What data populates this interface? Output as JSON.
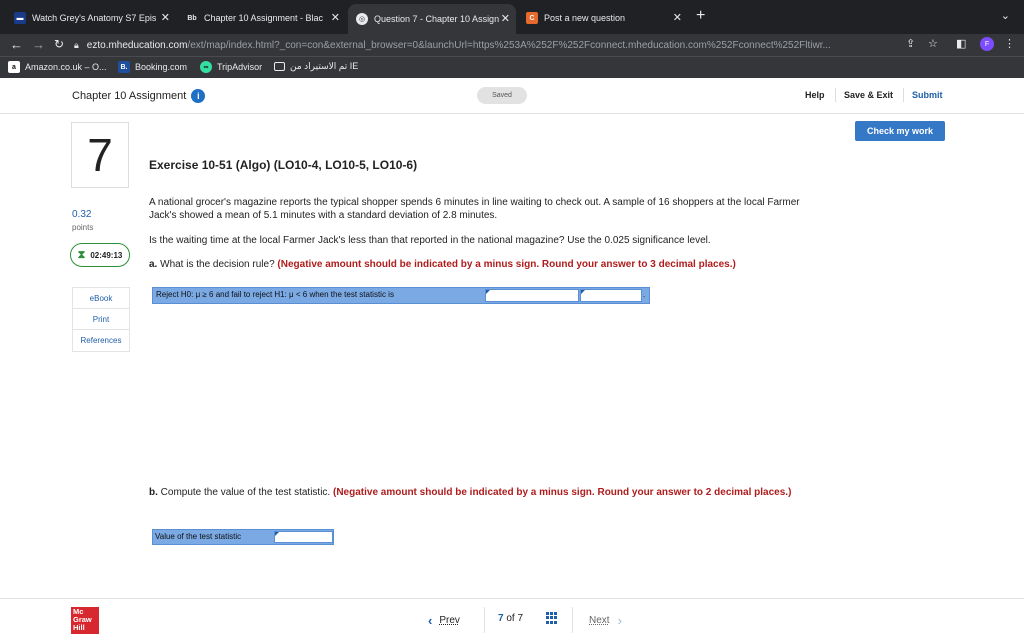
{
  "browser": {
    "tabs": [
      {
        "label": "Watch Grey's Anatomy S7 Epis",
        "icon": "tv-icon"
      },
      {
        "label": "Chapter 10 Assignment - Blac",
        "icon": "blackboard-icon"
      },
      {
        "label": "Question 7 - Chapter 10 Assign",
        "icon": "connect-icon"
      },
      {
        "label": "Post a new question",
        "icon": "chegg-icon"
      }
    ],
    "url_host": "ezto.mheducation.com",
    "url_path": "/ext/map/index.html?_con=con&external_browser=0&launchUrl=https%253A%252F%252Fconnect.mheducation.com%252Fconnect%252Fltiwr...",
    "profile_initial": "F",
    "bookmarks": [
      "Amazon.co.uk – O...",
      "Booking.com",
      "TripAdvisor",
      "تم الاستيراد من IE"
    ]
  },
  "header": {
    "assignment_title": "Chapter 10 Assignment",
    "saved": "Saved",
    "help": "Help",
    "save_exit": "Save & Exit",
    "submit": "Submit",
    "check_work": "Check my work"
  },
  "sidebar": {
    "question_number": "7",
    "points_value": "0.32",
    "points_label": "points",
    "timer": "02:49:13",
    "links": [
      "eBook",
      "Print",
      "References"
    ]
  },
  "question": {
    "title": "Exercise 10-51 (Algo) (LO10-4, LO10-5, LO10-6)",
    "intro": "A national grocer's magazine reports the typical shopper spends 6 minutes in line waiting to check out. A sample of 16 shoppers at the local Farmer Jack's showed a mean of 5.1 minutes with a standard deviation of 2.8 minutes.",
    "prompt": "Is the waiting time at the local Farmer Jack's less than that reported in the national magazine? Use the 0.025 significance level.",
    "part_a_label": "a.",
    "part_a_text": "What is the decision rule?",
    "part_a_note": "(Negative amount should be indicated by a minus sign. Round your answer to 3 decimal places.)",
    "rule_text": "Reject H0: μ ≥ 6 and fail to reject H1: μ < 6 when the test statistic is",
    "rule_suffix": ".",
    "part_b_label": "b.",
    "part_b_text": "Compute the value of the test statistic.",
    "part_b_note": "(Negative amount should be indicated by a minus sign. Round your answer to 2 decimal places.)",
    "stat_label": "Value of the test statistic"
  },
  "footer": {
    "logo": [
      "Mc",
      "Graw",
      "Hill"
    ],
    "prev": "Prev",
    "current": "7",
    "of_label": "of",
    "total": "7",
    "next": "Next"
  }
}
